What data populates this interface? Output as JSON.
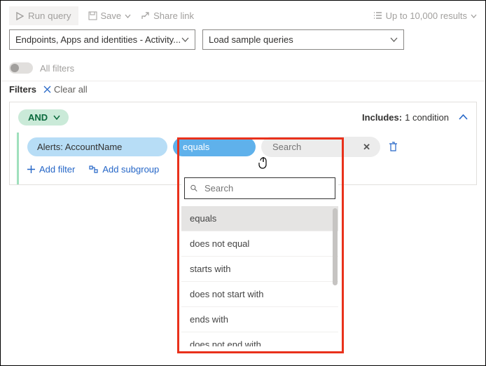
{
  "toolbar": {
    "run": "Run query",
    "save": "Save",
    "share": "Share link",
    "results": "Up to 10,000 results"
  },
  "selectors": {
    "scope": "Endpoints, Apps and identities - Activity...",
    "sample": "Load sample queries"
  },
  "filtersToggle": {
    "label": "All filters"
  },
  "filtersHeader": {
    "title": "Filters",
    "clear": "Clear all"
  },
  "builder": {
    "logic": "AND",
    "includesLabel": "Includes:",
    "includesCount": "1 condition",
    "field": "Alerts: AccountName",
    "operator": "equals",
    "searchPlaceholder": "Search",
    "addFilter": "Add filter",
    "addSubgroup": "Add subgroup"
  },
  "dropdown": {
    "searchPlaceholder": "Search",
    "items": [
      "equals",
      "does not equal",
      "starts with",
      "does not start with",
      "ends with",
      "does not end with"
    ],
    "selectedIndex": 0
  }
}
